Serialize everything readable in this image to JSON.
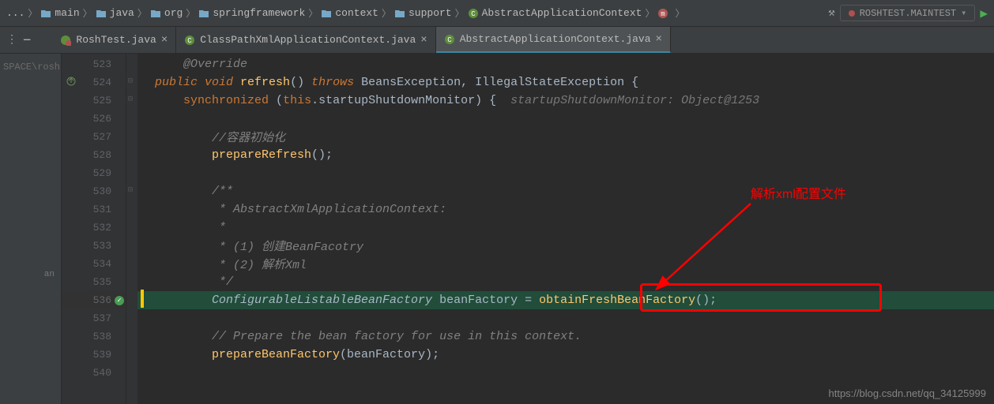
{
  "breadcrumbs": {
    "items": [
      {
        "icon": "folder",
        "label": "main"
      },
      {
        "icon": "folder",
        "label": "java"
      },
      {
        "icon": "folder",
        "label": "org"
      },
      {
        "icon": "folder",
        "label": "springframework"
      },
      {
        "icon": "folder",
        "label": "context"
      },
      {
        "icon": "folder",
        "label": "support"
      },
      {
        "icon": "class",
        "label": "AbstractApplicationContext"
      },
      {
        "icon": "method",
        "label": ""
      }
    ]
  },
  "run_config": {
    "label": "ROSHTEST.MAINTEST"
  },
  "left_panel": {
    "text": "SPACE\\rosh"
  },
  "tabs": {
    "items": [
      {
        "icon": "test",
        "label": "RoshTest.java",
        "active": false
      },
      {
        "icon": "java",
        "label": "ClassPathXmlApplicationContext.java",
        "active": false
      },
      {
        "icon": "java",
        "label": "AbstractApplicationContext.java",
        "active": true
      }
    ]
  },
  "gutter": {
    "start": 523,
    "highlighted": 536,
    "has_override": 524,
    "has_check": 536
  },
  "code": {
    "lines": [
      {
        "n": 523,
        "segs": [
          {
            "c": "comment",
            "t": "      @Override"
          }
        ]
      },
      {
        "n": 524,
        "segs": [
          {
            "c": "ident",
            "t": "  "
          },
          {
            "c": "kwi",
            "t": "public void "
          },
          {
            "c": "method",
            "t": "refresh"
          },
          {
            "c": "ident",
            "t": "() "
          },
          {
            "c": "kwi",
            "t": "throws "
          },
          {
            "c": "ident",
            "t": "BeansException, IllegalStateException {"
          }
        ]
      },
      {
        "n": 525,
        "segs": [
          {
            "c": "ident",
            "t": "      "
          },
          {
            "c": "kw",
            "t": "synchronized "
          },
          {
            "c": "ident",
            "t": "("
          },
          {
            "c": "kw",
            "t": "this"
          },
          {
            "c": "ident",
            "t": ".startupShutdownMonitor) {  "
          },
          {
            "c": "inlay",
            "t": "startupShutdownMonitor: Object@1253"
          }
        ]
      },
      {
        "n": 526,
        "segs": []
      },
      {
        "n": 527,
        "segs": [
          {
            "c": "ident",
            "t": "          "
          },
          {
            "c": "comment",
            "t": "//容器初始化"
          }
        ]
      },
      {
        "n": 528,
        "segs": [
          {
            "c": "ident",
            "t": "          "
          },
          {
            "c": "method",
            "t": "prepareRefresh"
          },
          {
            "c": "ident",
            "t": "();"
          }
        ]
      },
      {
        "n": 529,
        "segs": []
      },
      {
        "n": 530,
        "segs": [
          {
            "c": "ident",
            "t": "          "
          },
          {
            "c": "comment",
            "t": "/**"
          }
        ]
      },
      {
        "n": 531,
        "segs": [
          {
            "c": "ident",
            "t": "          "
          },
          {
            "c": "comment",
            "t": " * AbstractXmlApplicationContext:"
          }
        ]
      },
      {
        "n": 532,
        "segs": [
          {
            "c": "ident",
            "t": "          "
          },
          {
            "c": "comment",
            "t": " *"
          }
        ]
      },
      {
        "n": 533,
        "segs": [
          {
            "c": "ident",
            "t": "          "
          },
          {
            "c": "comment",
            "t": " * (1) 创建BeanFacotry"
          }
        ]
      },
      {
        "n": 534,
        "segs": [
          {
            "c": "ident",
            "t": "          "
          },
          {
            "c": "comment",
            "t": " * (2) 解析Xml"
          }
        ]
      },
      {
        "n": 535,
        "segs": [
          {
            "c": "ident",
            "t": "          "
          },
          {
            "c": "comment",
            "t": " */"
          }
        ]
      },
      {
        "n": 536,
        "hl": true,
        "segs": [
          {
            "c": "ident",
            "t": "          "
          },
          {
            "c": "type",
            "t": "ConfigurableListableBeanFactory"
          },
          {
            "c": "ident",
            "t": " beanFactory = "
          },
          {
            "c": "method",
            "t": "obtainFreshBeanFactory"
          },
          {
            "c": "ident",
            "t": "();"
          }
        ]
      },
      {
        "n": 537,
        "segs": []
      },
      {
        "n": 538,
        "segs": [
          {
            "c": "ident",
            "t": "          "
          },
          {
            "c": "comment",
            "t": "// Prepare the bean factory for use in this context."
          }
        ]
      },
      {
        "n": 539,
        "segs": [
          {
            "c": "ident",
            "t": "          "
          },
          {
            "c": "method",
            "t": "prepareBeanFactory"
          },
          {
            "c": "ident",
            "t": "(beanFactory);"
          }
        ]
      },
      {
        "n": 540,
        "segs": []
      }
    ]
  },
  "annotation": {
    "text": "解析xml配置文件"
  },
  "watermark": "https://blog.csdn.net/qq_34125999"
}
